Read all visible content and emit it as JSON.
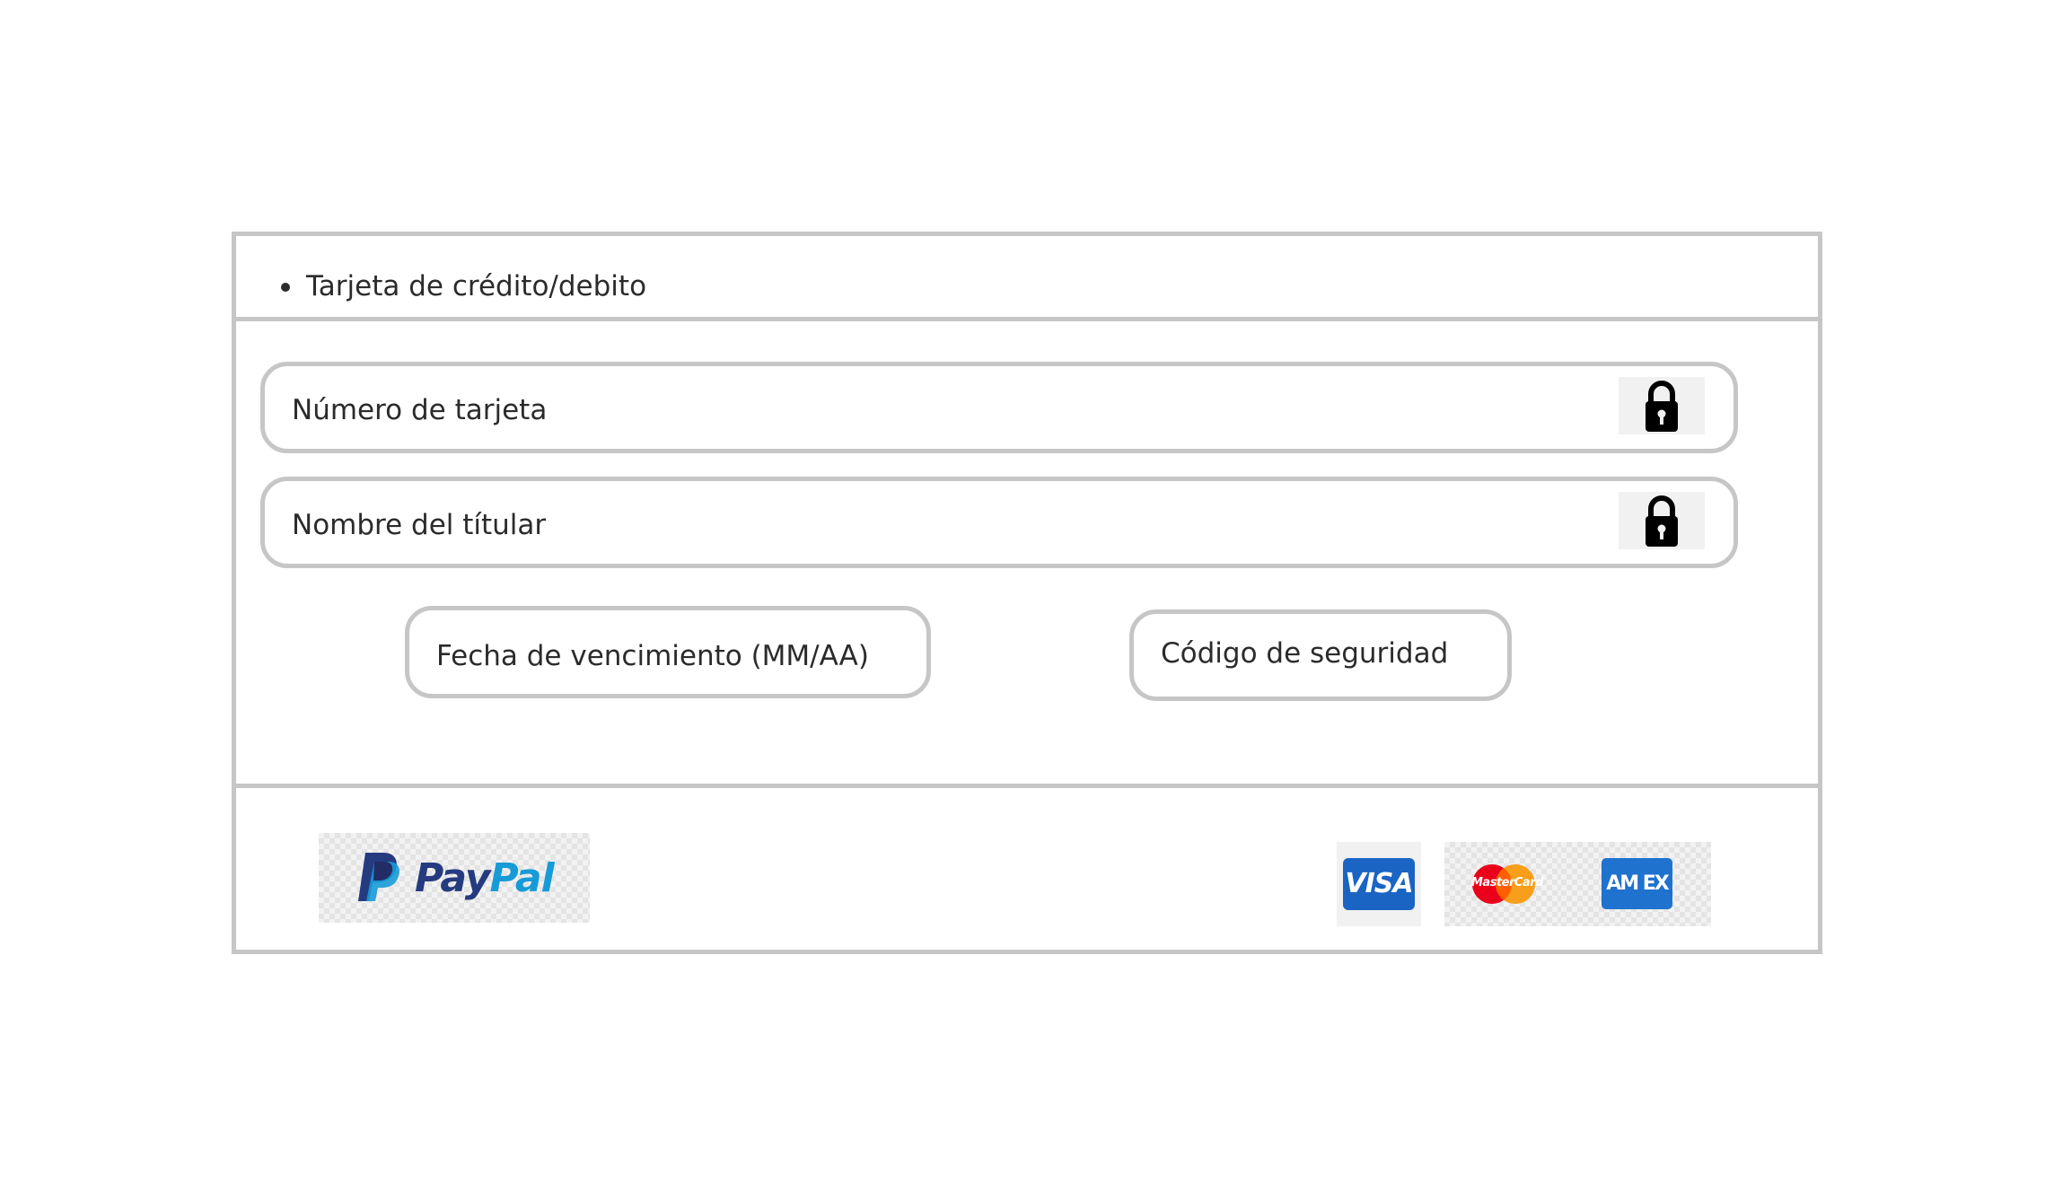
{
  "payment_method": {
    "label": "Tarjeta de crédito/debito"
  },
  "form": {
    "card_number": {
      "placeholder": "Número de tarjeta",
      "icon": "lock-icon"
    },
    "holder_name": {
      "placeholder": "Nombre del títular",
      "icon": "lock-icon"
    },
    "expiry": {
      "placeholder": "Fecha de vencimiento (MM/AA)"
    },
    "security_code": {
      "placeholder": "Código de seguridad"
    }
  },
  "footer": {
    "paypal": {
      "word_pay": "Pay",
      "word_pal": "Pal",
      "colors": {
        "pay": "#253b80",
        "pal": "#179bd7"
      }
    },
    "cards": {
      "visa": "VISA",
      "mastercard": "MasterCard",
      "amex": "AM EX"
    }
  },
  "colors": {
    "border": "#c6c6c6",
    "text": "#2b2b2b",
    "visa": "#1a64c4",
    "amex": "#1f72cd",
    "mastercard_red": "#eb001b",
    "mastercard_yellow": "#f79e1b"
  }
}
